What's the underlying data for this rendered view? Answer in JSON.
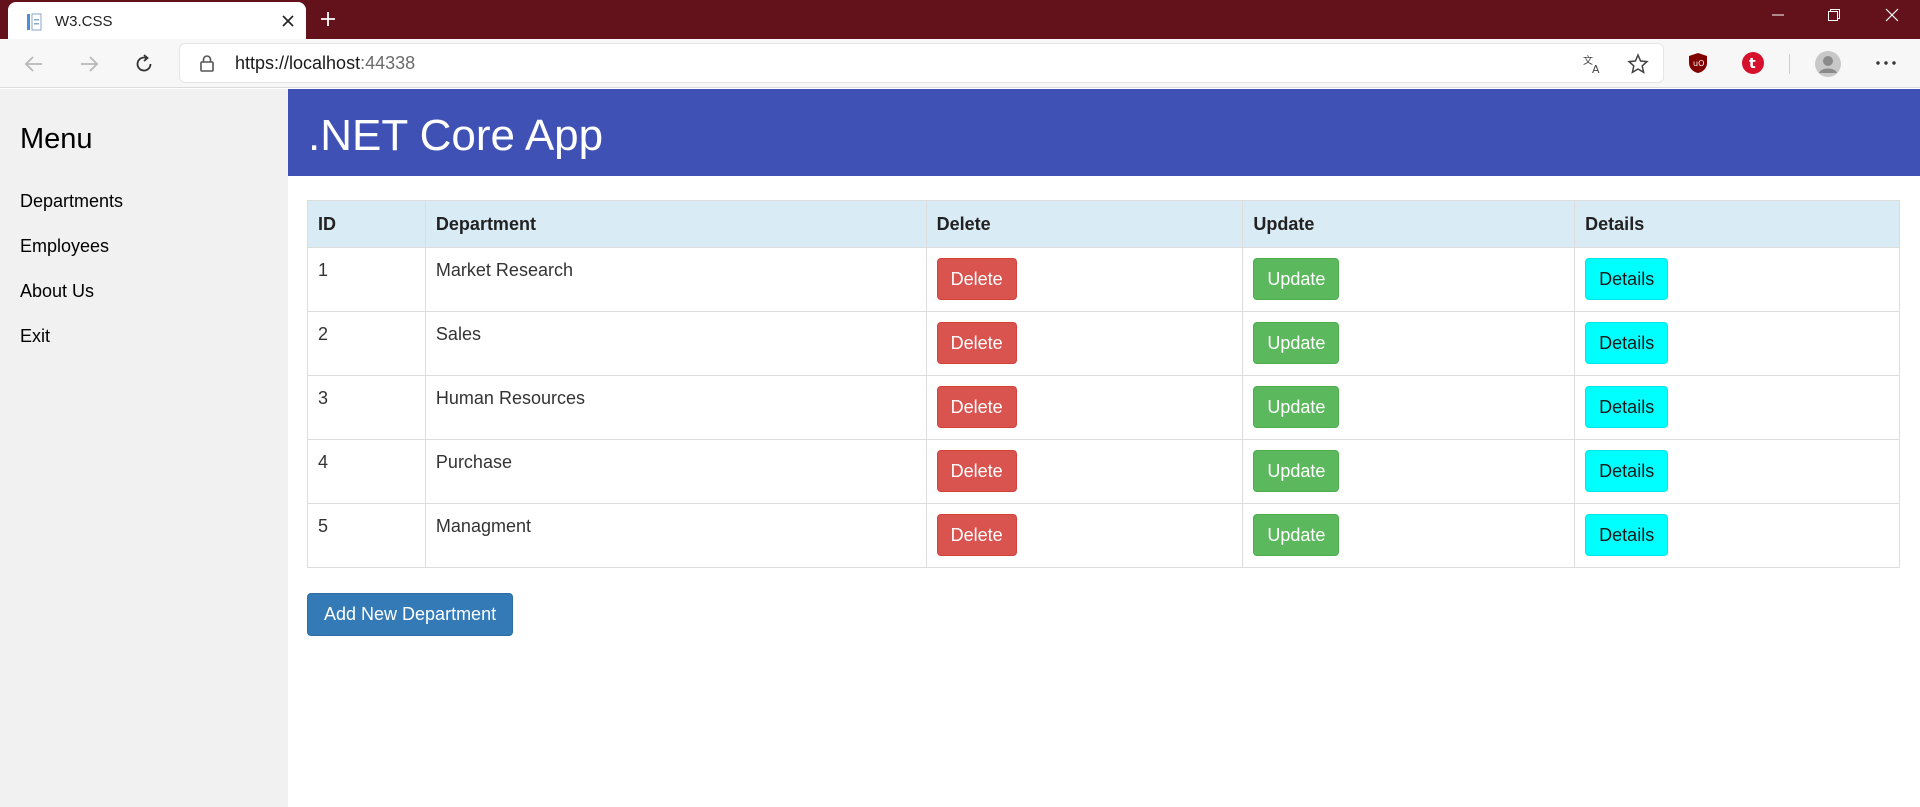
{
  "browser": {
    "tab_title": "W3.CSS",
    "url_host": "https://localhost",
    "url_port": ":44338",
    "colors": {
      "titlebar": "#63111b",
      "navbar": "#f7f7f7"
    },
    "icons": [
      "page-favicon-icon",
      "close-icon",
      "plus-icon",
      "minimize-icon",
      "restore-icon",
      "back-arrow-icon",
      "forward-arrow-icon",
      "reload-icon",
      "lock-icon",
      "translate-icon",
      "star-icon",
      "ublock-origin-icon",
      "tumblr-icon",
      "profile-icon",
      "more-icon"
    ]
  },
  "sidebar": {
    "title": "Menu",
    "items": [
      {
        "label": "Departments"
      },
      {
        "label": "Employees"
      },
      {
        "label": "About Us"
      },
      {
        "label": "Exit"
      }
    ]
  },
  "header": {
    "title": ".NET Core App",
    "color": "#3f51b5"
  },
  "table": {
    "columns": [
      "ID",
      "Department",
      "Delete",
      "Update",
      "Details"
    ],
    "rows": [
      {
        "id": "1",
        "department": "Market Research",
        "delete": "Delete",
        "update": "Update",
        "details": "Details"
      },
      {
        "id": "2",
        "department": "Sales",
        "delete": "Delete",
        "update": "Update",
        "details": "Details"
      },
      {
        "id": "3",
        "department": "Human Resources",
        "delete": "Delete",
        "update": "Update",
        "details": "Details"
      },
      {
        "id": "4",
        "department": "Purchase",
        "delete": "Delete",
        "update": "Update",
        "details": "Details"
      },
      {
        "id": "5",
        "department": "Managment",
        "delete": "Delete",
        "update": "Update",
        "details": "Details"
      }
    ],
    "colors": {
      "header_bg": "#d9ebf5",
      "delete": "#d9534f",
      "update": "#5cb85c",
      "details": "#00ffff"
    }
  },
  "add_button": {
    "label": "Add New Department",
    "color": "#337ab7"
  }
}
